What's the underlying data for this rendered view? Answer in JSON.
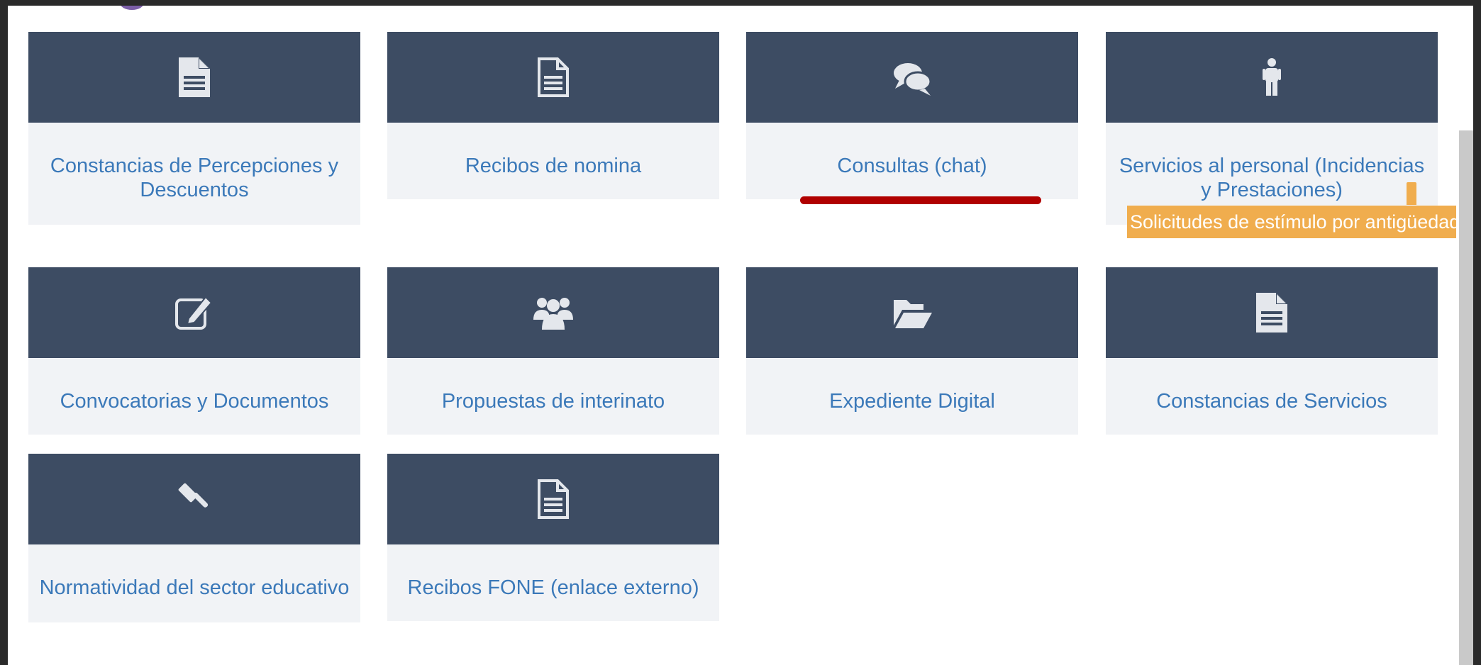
{
  "colors": {
    "header": "#3d4c63",
    "body": "#f1f3f6",
    "link": "#3b79b9",
    "accent_red": "#b00000",
    "highlight": "#f0ad4e"
  },
  "tiles": [
    {
      "label": "Constancias de Percepciones y Descuentos",
      "icon": "file-icon"
    },
    {
      "label": "Recibos de nomina",
      "icon": "file-text-outline-icon"
    },
    {
      "label": "Consultas (chat)",
      "icon": "chat-bubbles-icon"
    },
    {
      "label": "Servicios al personal (Incidencias y Prestaciones)",
      "icon": "person-icon"
    },
    {
      "label": "Convocatorias y Documentos",
      "icon": "edit-icon"
    },
    {
      "label": "Propuestas de interinato",
      "icon": "users-icon"
    },
    {
      "label": "Expediente Digital",
      "icon": "folder-open-icon"
    },
    {
      "label": "Constancias de Servicios",
      "icon": "file-icon"
    },
    {
      "label": "Normatividad del sector educativo",
      "icon": "gavel-icon"
    },
    {
      "label": "Recibos FONE (enlace externo)",
      "icon": "file-text-outline-icon"
    }
  ],
  "highlight_text": "Solicitudes de estímulo por antigüedad."
}
